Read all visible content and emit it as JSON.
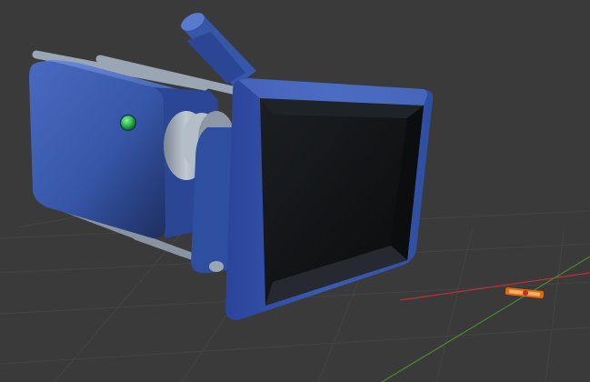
{
  "viewport": {
    "view": "3d-viewport",
    "background_color": "#3a3a3a",
    "grid_color": "#444444",
    "axis_x_color": "#c03030",
    "axis_y_color": "#4a8a2a"
  },
  "model": {
    "object": "camera",
    "body_color": "#3a5aa8",
    "body_highlight_color": "#6a8ad8",
    "body_shadow_color": "#1e2e60",
    "rod_color": "#9aa6b4",
    "lens_ring_color": "#aab4c0",
    "indicator_color": "#2ab84a",
    "hood_interior_color": "#141618"
  },
  "gizmo": {
    "icon": "light-gizmo-icon",
    "color": "#e06a10"
  }
}
